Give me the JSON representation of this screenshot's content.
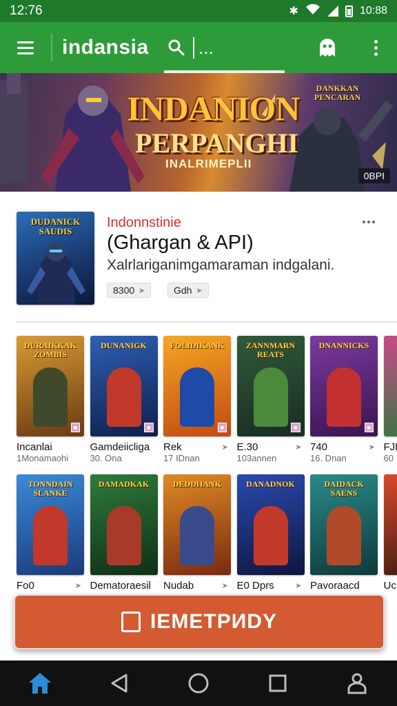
{
  "status_bar": {
    "time": "12:76",
    "clock": "10:88",
    "icons": [
      "bluetooth-icon",
      "wifi-icon",
      "signal-icon",
      "battery-icon"
    ]
  },
  "app_bar": {
    "title": "indansia",
    "search_placeholder": "...",
    "icons": [
      "menu-icon",
      "search-icon",
      "ghost-icon",
      "more-vert-icon"
    ]
  },
  "banner": {
    "title": "INDANION",
    "subtitle": "PERPANGHI",
    "tagline": "INALRIMEPLII",
    "count_badge": "0BPI",
    "logo_text": "DANKKAN",
    "logo_subtext": "PENCARAN"
  },
  "featured": {
    "cover_title": "DUDANICK",
    "cover_subtitle": "SAUDIS",
    "developer": "Indonnstinie",
    "title": "(Ghargan & API)",
    "description": "Xalrlariganimgamaraman indgalani.",
    "chips": [
      "8300",
      "Gdh"
    ]
  },
  "grid_rows": [
    {
      "cards": [
        {
          "cover_title": "DURAIKKAK ZOMBIS",
          "name": "Incanlai",
          "meta": "1Monamaohi",
          "pinned": false,
          "colors": [
            "#d79a32",
            "#6a3a14"
          ],
          "hero": "#3e4a2a"
        },
        {
          "cover_title": "DUNANIGK",
          "name": "Gamdeiicliga",
          "meta": "30. Ona",
          "pinned": false,
          "colors": [
            "#2d5fb5",
            "#0f1f4a"
          ],
          "hero": "#c0392b"
        },
        {
          "cover_title": "FOLIDIKANK",
          "name": "Rek",
          "meta": "17 IDnan",
          "pinned": true,
          "colors": [
            "#f5a623",
            "#c24a12"
          ],
          "hero": "#1f4aa8"
        },
        {
          "cover_title": "ZANNMARN REATS",
          "name": "E.30",
          "meta": "103annen",
          "pinned": true,
          "colors": [
            "#2f5a3a",
            "#1a2c22"
          ],
          "hero": "#4a8a3a"
        },
        {
          "cover_title": "DNANNICKS",
          "name": "740",
          "meta": "16. Dnan",
          "pinned": true,
          "colors": [
            "#7b3aa0",
            "#3a1450"
          ],
          "hero": "#c23030"
        },
        {
          "cover_title": "DN",
          "name": "FJL",
          "meta": "60",
          "pinned": false,
          "colors": [
            "#c94a8a",
            "#2a7a3a"
          ],
          "hero": "#2a5a9a"
        }
      ]
    },
    {
      "cards": [
        {
          "cover_title": "TONNDAIN SLANKE",
          "name": "Fo0",
          "meta": "",
          "pinned": true,
          "colors": [
            "#3a8ad8",
            "#1c3a7a"
          ],
          "hero": "#c0392b"
        },
        {
          "cover_title": "DAMADKAK",
          "name": "Dematoraesil",
          "meta": "",
          "pinned": false,
          "colors": [
            "#2e7a3a",
            "#0f3018"
          ],
          "hero": "#a83a2a"
        },
        {
          "cover_title": "DEDDHANK",
          "name": "Nudab",
          "meta": "",
          "pinned": true,
          "colors": [
            "#e08a24",
            "#7a2a10"
          ],
          "hero": "#3a4a8a"
        },
        {
          "cover_title": "DANADNOK",
          "name": "E0 Dprs",
          "meta": "",
          "pinned": true,
          "colors": [
            "#2a4ab0",
            "#0f1640"
          ],
          "hero": "#c23a2a"
        },
        {
          "cover_title": "DAIDACK SAENS",
          "name": "Pavoraacd",
          "meta": "",
          "pinned": false,
          "colors": [
            "#2a8a8a",
            "#0f3a3a"
          ],
          "hero": "#b04a2a"
        },
        {
          "cover_title": "D",
          "name": "Uc",
          "meta": "",
          "pinned": false,
          "colors": [
            "#d84a2a",
            "#3a1a10"
          ],
          "hero": "#4a2a8a"
        }
      ]
    }
  ],
  "cta": {
    "label": "IEMETPИDY",
    "icon": "install-icon",
    "color": "#d45a31"
  },
  "nav_bar": {
    "icons": [
      "home-icon",
      "back-icon",
      "home-circle-icon",
      "recents-icon",
      "profile-icon"
    ],
    "active_color": "#2b8ed9"
  }
}
